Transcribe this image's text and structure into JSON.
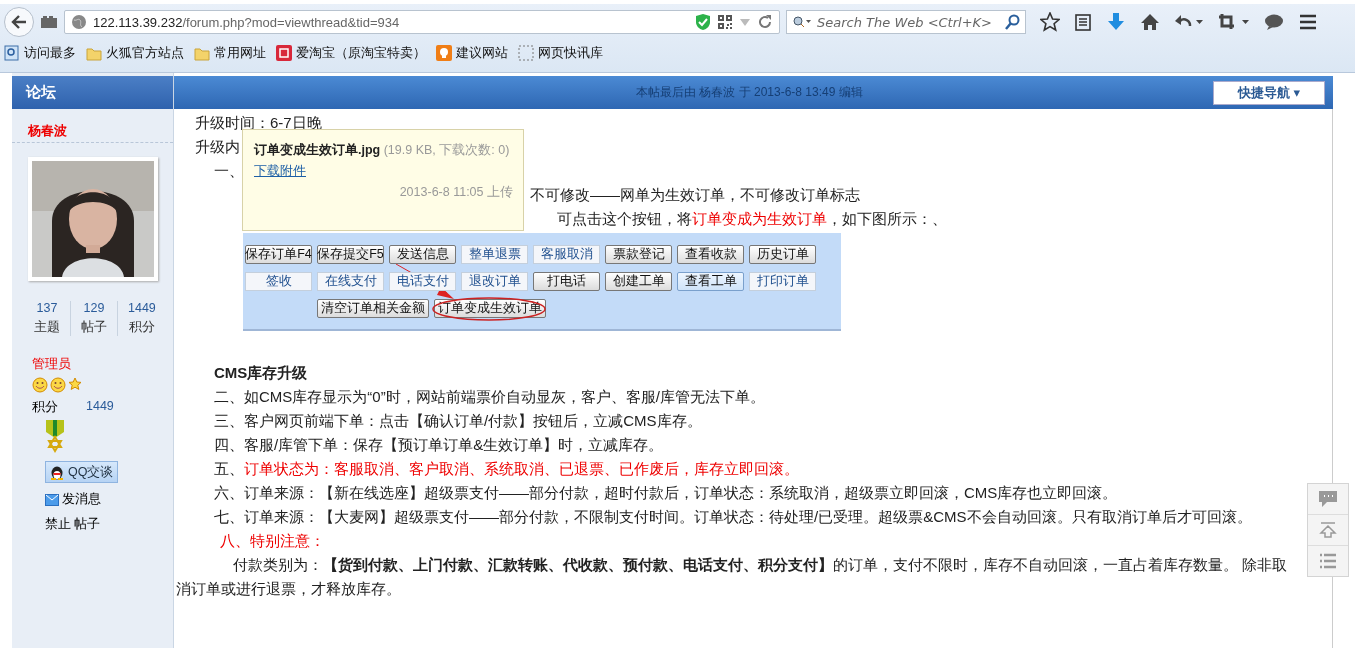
{
  "browser": {
    "url_host": "122.113.39.232",
    "url_path": "/forum.php?mod=viewthread&tid=934",
    "search": {
      "placeholder": "Search The Web <Ctrl+K>"
    },
    "bookmarks": [
      {
        "label": "访问最多",
        "kind": "search"
      },
      {
        "label": "火狐官方站点",
        "kind": "folder"
      },
      {
        "label": "常用网址",
        "kind": "folder"
      },
      {
        "label": "爱淘宝（原淘宝特卖）",
        "kind": "taobao"
      },
      {
        "label": "建议网站",
        "kind": "bulb"
      },
      {
        "label": "网页快讯库",
        "kind": "slice"
      }
    ]
  },
  "forum_bar": {
    "tab": "论坛",
    "edit_note": "本帖最后由 杨春波 于 2013-6-8 13:49 编辑",
    "quick_nav": "快捷导航 ▾"
  },
  "author": {
    "name": "杨春波",
    "stats": [
      {
        "value": "137",
        "label": "主题"
      },
      {
        "value": "129",
        "label": "帖子"
      },
      {
        "value": "1449",
        "label": "积分"
      }
    ],
    "group": "管理员",
    "points_label": "积分",
    "points": "1449",
    "qq_button": "QQ交谈",
    "message_link": "发消息",
    "ban_link": "禁止 帖子"
  },
  "post": {
    "lines": [
      {
        "kind": "plain",
        "text": "升级时间：6-7日晚"
      },
      {
        "kind": "plain",
        "text": "升级内"
      },
      {
        "kind": "item",
        "text": "一、"
      },
      {
        "kind": "after_tip",
        "text": "不可修改——网单为生效订单，不可修改订单标志"
      },
      {
        "kind": "after_tip_far",
        "segments": [
          {
            "text": "可点击这个按钮，将",
            "red": false
          },
          {
            "text": "订单变成为生效订单",
            "red": true
          },
          {
            "text": "，如下图所示：、",
            "red": false
          }
        ]
      }
    ],
    "screenshot": {
      "rows": [
        {
          "buttons": [
            {
              "label": "保存订单F4",
              "raised": true,
              "hover": false
            },
            {
              "label": "保存提交F5",
              "raised": true,
              "hover": false
            },
            {
              "label": "发送信息",
              "raised": true,
              "hover": false
            },
            {
              "label": "整单退票",
              "raised": false,
              "hover": false
            },
            {
              "label": "客服取消",
              "raised": false,
              "hover": false
            },
            {
              "label": "票款登记",
              "raised": true,
              "hover": false
            },
            {
              "label": "查看收款",
              "raised": true,
              "hover": false
            },
            {
              "label": "历史订单",
              "raised": true,
              "hover": false
            }
          ]
        },
        {
          "buttons": [
            {
              "label": "签收",
              "raised": false,
              "hover": false
            },
            {
              "label": "在线支付",
              "raised": false,
              "hover": false
            },
            {
              "label": "电话支付",
              "raised": false,
              "hover": false
            },
            {
              "label": "退改订单",
              "raised": false,
              "hover": false
            },
            {
              "label": "打电话",
              "raised": true,
              "hover": false
            },
            {
              "label": "创建工单",
              "raised": true,
              "hover": false
            },
            {
              "label": "查看工单",
              "raised": true,
              "hover": true
            },
            {
              "label": "打印订单",
              "raised": false,
              "hover": false
            }
          ]
        },
        {
          "buttons": [
            {
              "label": "清空订单相关金额",
              "raised": true,
              "hover": false
            },
            {
              "label": "订单变成生效订单",
              "raised": true,
              "hover": false
            }
          ]
        }
      ]
    },
    "attachment_tip": {
      "filename": "订单变成生效订单.jpg",
      "meta": "(19.9 KB, 下载次数: 0)",
      "download": "下载附件",
      "uploaded": "2013-6-8 11:05 上传"
    },
    "body": [
      {
        "kind": "heading",
        "text": "CMS库存升级"
      },
      {
        "kind": "para",
        "text": "二、如CMS库存显示为“0”时，网站前端票价自动显灰，客户、客服/库管无法下单。"
      },
      {
        "kind": "para",
        "text": "三、客户网页前端下单：点击【确认订单/付款】按钮后，立减CMS库存。"
      },
      {
        "kind": "para",
        "text": "四、客服/库管下单：保存【预订单订单&生效订单】时，立减库存。"
      },
      {
        "kind": "para",
        "segments": [
          {
            "text": "五、",
            "red": false
          },
          {
            "text": "订单状态为：客服取消、客户取消、系统取消、已退票、已作废后，库存立即回滚。",
            "red": true
          }
        ]
      },
      {
        "kind": "para",
        "text": "六、订单来源：【新在线选座】超级票支付——部分付款，超时付款后，订单状态：系统取消，超级票立即回滚，CMS库存也立即回滚。"
      },
      {
        "kind": "para",
        "text": "七、订单来源：【大麦网】超级票支付——部分付款，不限制支付时间。订单状态：待处理/已受理。超级票&CMS不会自动回滚。只有取消订单后才可回滚。"
      },
      {
        "kind": "note",
        "text": "八、特别注意："
      },
      {
        "kind": "indented",
        "text": "付款类别为：**【货到付款、上门付款、汇款转账、代收款、预付款、电话支付、积分支付】**的订单，支付不限时，库存不自动回滚，一直占着库存数量。 除非取消订单或进行退票，才释放库存。"
      }
    ]
  }
}
